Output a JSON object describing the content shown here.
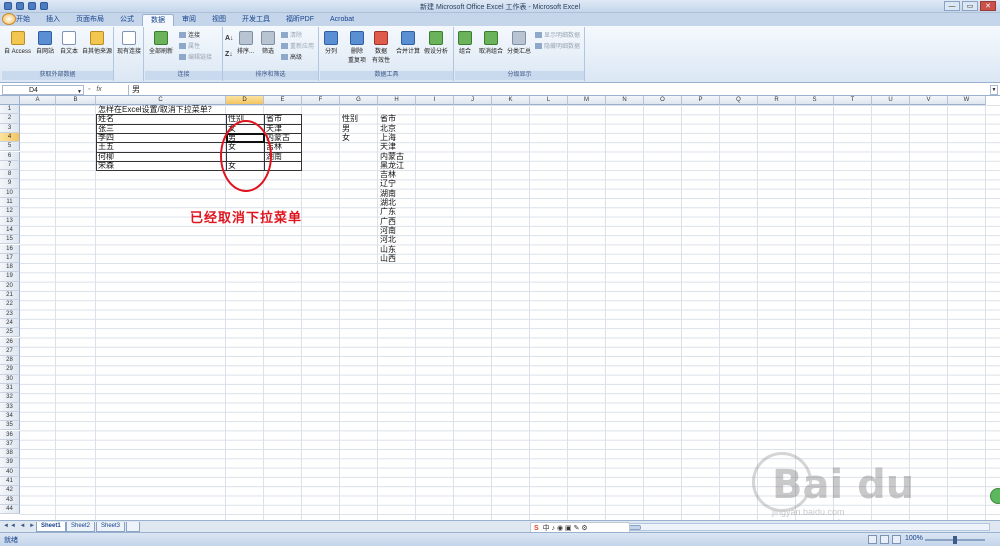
{
  "window": {
    "title": "新建 Microsoft Office Excel 工作表 - Microsoft Excel",
    "minimize": "—",
    "maximize": "▭",
    "close": "✕"
  },
  "tabs": [
    "开始",
    "插入",
    "页面布局",
    "公式",
    "数据",
    "审阅",
    "视图",
    "开发工具",
    "福昕PDF",
    "Acrobat"
  ],
  "ribbon": {
    "groups": {
      "external": "获取外部数据",
      "connections": "连接",
      "sort_filter": "排序和筛选",
      "data_tools": "数据工具",
      "outline": "分级显示"
    },
    "buttons": {
      "access": "自 Access",
      "web": "自网站",
      "text": "自文本",
      "other": "自其他来源",
      "existing": "现有连接",
      "refresh_all": "全部刷新",
      "connections": "连接",
      "properties": "属性",
      "edit_links": "编辑链接",
      "sort": "排序...",
      "filter": "筛选",
      "clear": "清除",
      "reapply": "重新应用",
      "advanced": "高级",
      "text_to_cols": "分列",
      "remove_dup": "删除\n重复项",
      "validation": "数据\n有效性",
      "consolidate": "合并计算",
      "whatif": "假设分析",
      "group": "组合",
      "ungroup": "取消组合",
      "subtotal": "分类汇总",
      "show_detail": "显示明细数据",
      "hide_detail": "隐藏明细数据"
    }
  },
  "formula_bar": {
    "name_box": "D4",
    "fx": "fx",
    "value": "男"
  },
  "columns": [
    "A",
    "B",
    "C",
    "D",
    "E",
    "F",
    "G",
    "H",
    "I",
    "J",
    "K",
    "L",
    "M",
    "N",
    "O",
    "P",
    "Q",
    "R",
    "S",
    "T",
    "U",
    "V",
    "W"
  ],
  "rows": [
    "1",
    "2",
    "3",
    "4",
    "5",
    "6",
    "7",
    "8",
    "9",
    "10",
    "11",
    "12",
    "13",
    "14",
    "15",
    "16",
    "17",
    "18",
    "19",
    "20",
    "21",
    "22",
    "23",
    "24",
    "25",
    "26",
    "27",
    "28",
    "29",
    "30",
    "31",
    "32",
    "33",
    "34",
    "35",
    "36",
    "37",
    "38",
    "39",
    "40",
    "41",
    "42",
    "43",
    "44"
  ],
  "sheet": {
    "title_cell": "怎样在Excel设置/取消下拉菜单？",
    "headers": {
      "name": "姓名",
      "gender": "性别",
      "city": "省市"
    },
    "names": [
      "张三",
      "李四",
      "王五",
      "何柳",
      "宋森"
    ],
    "genders": [
      "女",
      "男",
      "女",
      "",
      "女"
    ],
    "cities": [
      "天津",
      "内蒙古",
      "吉林",
      "湖南",
      ""
    ],
    "g_col": [
      "性别",
      "男",
      "女"
    ],
    "h_col": [
      "省市",
      "北京",
      "上海",
      "天津",
      "内蒙古",
      "黑龙江",
      "吉林",
      "辽宁",
      "湖南",
      "湖北",
      "广东",
      "广西",
      "河南",
      "河北",
      "山东",
      "山西"
    ]
  },
  "annotation": "已经取消下拉菜单",
  "sheet_tabs": [
    "Sheet1",
    "Sheet2",
    "Sheet3"
  ],
  "status": {
    "ready": "就绪",
    "zoom": "100%"
  },
  "ime": "中",
  "watermark": {
    "text": "Bai du 经验",
    "sub": "jingyan.baidu.com"
  }
}
